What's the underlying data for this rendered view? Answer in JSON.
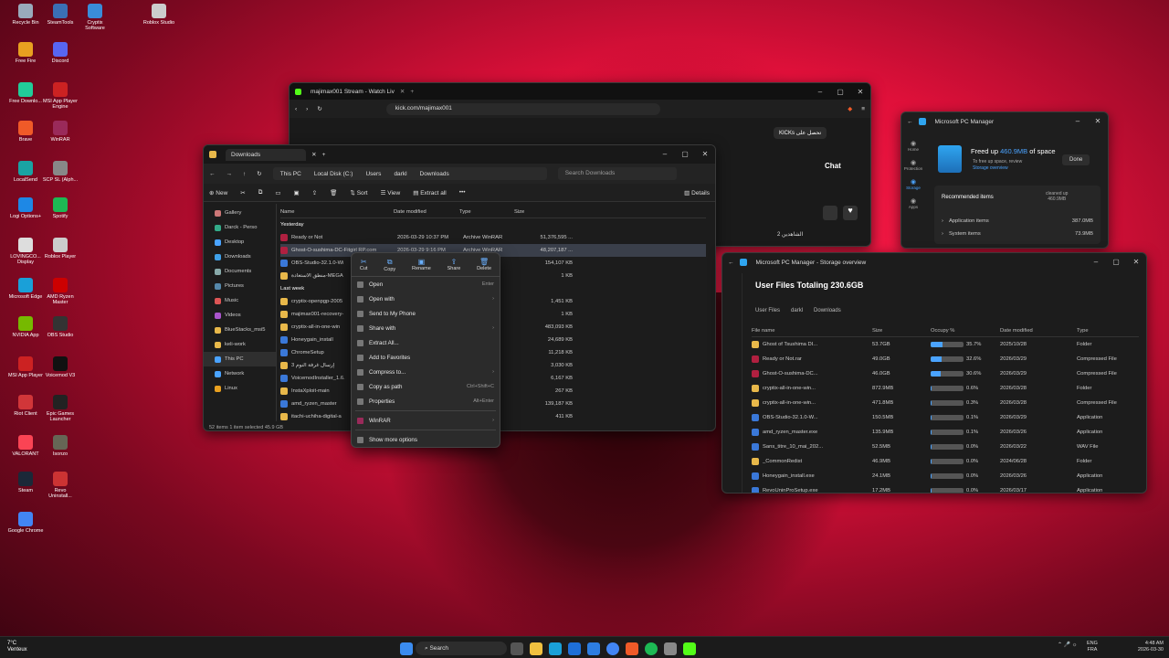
{
  "desktop": {
    "icons": [
      {
        "label": "Recycle Bin",
        "color": "#9ab"
      },
      {
        "label": "SteamTools",
        "color": "#3b6fb5"
      },
      {
        "label": "Cryptix Software",
        "color": "#3a8cd8"
      },
      {
        "label": "Roblox Studio",
        "color": "#ccc"
      },
      {
        "label": "Free Fire",
        "color": "#e8a020"
      },
      {
        "label": "Discord",
        "color": "#5865f2"
      },
      {
        "label": "Free Downlo...",
        "color": "#2c9"
      },
      {
        "label": "MSI App Player Engine",
        "color": "#c22"
      },
      {
        "label": "Brave",
        "color": "#f05a28"
      },
      {
        "label": "WinRAR",
        "color": "#9a2a5a"
      },
      {
        "label": "LocalSend",
        "color": "#1aa3a3"
      },
      {
        "label": "SCP SL (Alph...",
        "color": "#888"
      },
      {
        "label": "Logi Options+",
        "color": "#1e88e5"
      },
      {
        "label": "Spotify",
        "color": "#1db954"
      },
      {
        "label": "LOVINGCO... Display",
        "color": "#ddd"
      },
      {
        "label": "Roblox Player",
        "color": "#ccc"
      },
      {
        "label": "Microsoft Edge",
        "color": "#1aa0d8"
      },
      {
        "label": "AMD Ryzen Master",
        "color": "#c00"
      },
      {
        "label": "NVIDIA App",
        "color": "#76b900"
      },
      {
        "label": "OBS Studio",
        "color": "#333"
      },
      {
        "label": "MSI App Player",
        "color": "#c22"
      },
      {
        "label": "Voicemod V3",
        "color": "#111"
      },
      {
        "label": "Riot Client",
        "color": "#d13639"
      },
      {
        "label": "Epic Games Launcher",
        "color": "#222"
      },
      {
        "label": "VALORANT",
        "color": "#fa4454"
      },
      {
        "label": "Isonzo",
        "color": "#665"
      },
      {
        "label": "Steam",
        "color": "#1b2838"
      },
      {
        "label": "Revo Uninstall...",
        "color": "#c33"
      },
      {
        "label": "Google Chrome",
        "color": "#4285f4"
      }
    ]
  },
  "browser": {
    "tab_title": "majimax001 Stream - Watch Liv",
    "url": "kick.com/majimax001",
    "chat_label": "Chat",
    "kick_btn": "KICKs تحصل على",
    "viewer_text": "الشاهدين 2"
  },
  "explorer": {
    "back_tab": "This PC",
    "tab_title": "Downloads",
    "breadcrumb": [
      "This PC",
      "Local Disk (C:)",
      "Users",
      "darkl",
      "Downloads"
    ],
    "search_placeholder": "Search Downloads",
    "toolbar": {
      "new": "New",
      "sort": "Sort",
      "view": "View",
      "extract": "Extract all",
      "details": "Details"
    },
    "headers": {
      "name": "Name",
      "date": "Date modified",
      "type": "Type",
      "size": "Size"
    },
    "group_yesterday": "Yesterday",
    "group_lastweek": "Last week",
    "nav": [
      "Gallery",
      "Darck - Perso",
      "Desktop",
      "Downloads",
      "Documents",
      "Pictures",
      "Music",
      "Videos",
      "BlueStacks_msi5",
      "keli-work",
      "This PC",
      "Network",
      "Linux"
    ],
    "files_y": [
      {
        "name": "Ready or Not",
        "date": "2026-03-29 10:37 PM",
        "type": "Archive WinRAR",
        "size": "51,376,595 ...",
        "kind": "rar"
      },
      {
        "name": "Ghost-O-sushima-DC-Fitgirl RP.com",
        "date": "2026-03-29 9:16 PM",
        "type": "Archive WinRAR",
        "size": "48,207,187 ...",
        "kind": "rar"
      },
      {
        "name": "OBS-Studio-32.1.0-Wi",
        "date": "",
        "type": "",
        "size": "154,107 KB",
        "kind": "app"
      },
      {
        "name": "منطق الاستعادة-MEGA",
        "date": "",
        "type": "ent",
        "size": "1 KB",
        "kind": "folder"
      }
    ],
    "files_w": [
      {
        "name": "cryptix-openpgp-2005",
        "type": "(zipp...",
        "size": "1,451 KB",
        "kind": "folder"
      },
      {
        "name": "majimax001-recovery-",
        "type": "ent",
        "size": "1 KB",
        "kind": "folder"
      },
      {
        "name": "cryptix-all-in-one-win",
        "type": "(zipp...",
        "size": "483,093 KB",
        "kind": "folder"
      },
      {
        "name": "Honeygain_install",
        "type": "",
        "size": "24,689 KB",
        "kind": "app"
      },
      {
        "name": "ChromeSetup",
        "type": "",
        "size": "11,218 KB",
        "kind": "app"
      },
      {
        "name": "إرسال غرفة النوم 3",
        "type": "(zipp...",
        "size": "3,030 KB",
        "kind": "folder"
      },
      {
        "name": "VoicemodInstaller_1.6.",
        "type": "",
        "size": "6,167 KB",
        "kind": "app"
      },
      {
        "name": "InstaXploit-main",
        "type": "(zipp...",
        "size": "267 KB",
        "kind": "folder"
      },
      {
        "name": "amd_ryzen_master",
        "type": "",
        "size": "139,187 KB",
        "kind": "app"
      },
      {
        "name": "itachi-uchiha-digital-a",
        "type": "",
        "size": "411 KB",
        "kind": "folder"
      }
    ],
    "status": "52 items    1 item selected  45.9 GB"
  },
  "context_menu": {
    "top": [
      "Cut",
      "Copy",
      "Rename",
      "Share",
      "Delete"
    ],
    "items": [
      {
        "label": "Open",
        "shortcut": "Enter",
        "arrow": ""
      },
      {
        "label": "Open with",
        "shortcut": "",
        "arrow": "›"
      },
      {
        "label": "Send to My Phone",
        "shortcut": "",
        "arrow": ""
      },
      {
        "label": "Share with",
        "shortcut": "",
        "arrow": "›"
      },
      {
        "label": "Extract All...",
        "shortcut": "",
        "arrow": ""
      },
      {
        "label": "Add to Favorites",
        "shortcut": "",
        "arrow": ""
      },
      {
        "label": "Compress to...",
        "shortcut": "",
        "arrow": "›"
      },
      {
        "label": "Copy as path",
        "shortcut": "Ctrl+Shift+C",
        "arrow": ""
      },
      {
        "label": "Properties",
        "shortcut": "Alt+Enter",
        "arrow": ""
      }
    ],
    "winrar": "WinRAR",
    "more": "Show more options"
  },
  "pcmanager": {
    "title": "Microsoft PC Manager",
    "freed": "Freed up 460.9MB of space",
    "freed_prefix": "Freed up ",
    "freed_value": "460.9MB",
    "freed_suffix": " of space",
    "tip": "To free up space, review",
    "link": "Storage overview",
    "done": "Done",
    "recommended": "Recommended items",
    "cleaned": "cleaned up",
    "cleaned_val": "460.9MB",
    "items": [
      {
        "label": "Application items",
        "val": "387.0MB"
      },
      {
        "label": "System items",
        "val": "73.9MB"
      }
    ],
    "side": [
      "Home",
      "Protection",
      "Storage",
      "Apps"
    ]
  },
  "storage": {
    "title": "Microsoft PC Manager - Storage overview",
    "heading": "User Files Totaling 230.6GB",
    "crumbs": [
      "User Files",
      "darkl",
      "Downloads"
    ],
    "headers": {
      "name": "File name",
      "size": "Size",
      "occ": "Occupy %",
      "date": "Date modified",
      "type": "Type"
    },
    "rows": [
      {
        "name": "Ghost of Tsushima DI...",
        "size": "53.7GB",
        "pct": 35.7,
        "pct_label": "35.7%",
        "date": "2025/10/28",
        "type": "Folder",
        "kind": "folder"
      },
      {
        "name": "Ready or Not.rar",
        "size": "49.0GB",
        "pct": 32.6,
        "pct_label": "32.6%",
        "date": "2026/03/29",
        "type": "Compressed File",
        "kind": "rar"
      },
      {
        "name": "Ghost-O-sushima-DC...",
        "size": "46.0GB",
        "pct": 30.6,
        "pct_label": "30.6%",
        "date": "2026/03/29",
        "type": "Compressed File",
        "kind": "rar"
      },
      {
        "name": "cryptix-all-in-one-win...",
        "size": "872.9MB",
        "pct": 0.6,
        "pct_label": "0.6%",
        "date": "2026/03/28",
        "type": "Folder",
        "kind": "folder"
      },
      {
        "name": "cryptix-all-in-one-win...",
        "size": "471.8MB",
        "pct": 0.3,
        "pct_label": "0.3%",
        "date": "2026/03/28",
        "type": "Compressed File",
        "kind": "folder"
      },
      {
        "name": "OBS-Studio-32.1.0-W...",
        "size": "150.5MB",
        "pct": 0.1,
        "pct_label": "0.1%",
        "date": "2026/03/29",
        "type": "Application",
        "kind": "app"
      },
      {
        "name": "amd_ryzen_master.exe",
        "size": "135.9MB",
        "pct": 0.1,
        "pct_label": "0.1%",
        "date": "2026/03/26",
        "type": "Application",
        "kind": "app"
      },
      {
        "name": "Sans_titre_10_mai_202...",
        "size": "52.5MB",
        "pct": 0.0,
        "pct_label": "0.0%",
        "date": "2026/03/22",
        "type": "WAV File",
        "kind": "app"
      },
      {
        "name": "_CommonRedist",
        "size": "46.9MB",
        "pct": 0.0,
        "pct_label": "0.0%",
        "date": "2024/06/28",
        "type": "Folder",
        "kind": "folder"
      },
      {
        "name": "Honeygain_install.exe",
        "size": "24.1MB",
        "pct": 0.0,
        "pct_label": "0.0%",
        "date": "2026/03/26",
        "type": "Application",
        "kind": "app"
      },
      {
        "name": "RevoUninProSetup.exe",
        "size": "17.2MB",
        "pct": 0.0,
        "pct_label": "0.0%",
        "date": "2026/03/17",
        "type": "Application",
        "kind": "app"
      }
    ]
  },
  "taskbar": {
    "search": "Search",
    "weather_temp": "7°C",
    "weather_desc": "Venteux",
    "lang1": "ENG",
    "lang2": "FRA",
    "time": "4:48 AM",
    "date": "2026-03-30"
  }
}
